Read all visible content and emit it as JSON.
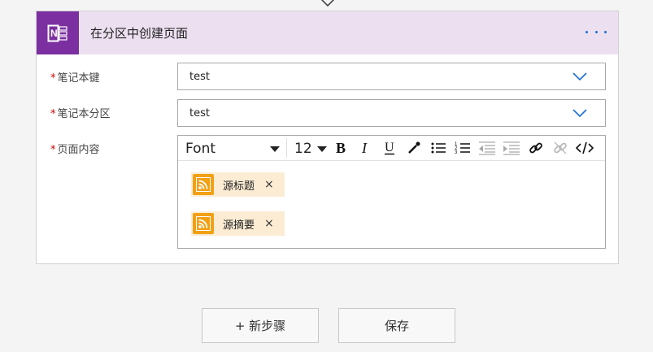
{
  "card": {
    "title": "在分区中创建页面",
    "more_icon": "ellipsis-icon",
    "app_icon": "onenote-icon"
  },
  "fields": {
    "notebook_key": {
      "label": "笔记本键",
      "required": "*",
      "value": "test"
    },
    "notebook_section": {
      "label": "笔记本分区",
      "required": "*",
      "value": "test"
    },
    "page_content": {
      "label": "页面内容",
      "required": "*"
    }
  },
  "editor": {
    "font": "Font",
    "size": "12",
    "tools": [
      "bold-icon",
      "italic-icon",
      "underline-icon",
      "color-picker-icon",
      "bulleted-list-icon",
      "numbered-list-icon",
      "outdent-icon",
      "indent-icon",
      "link-icon",
      "unlink-icon",
      "code-view-icon"
    ],
    "tokens": [
      {
        "label": "源标题",
        "remove": "×"
      },
      {
        "label": "源摘要",
        "remove": "×"
      }
    ]
  },
  "actions": {
    "new_step": "+ 新步骤",
    "save": "保存"
  },
  "colors": {
    "header_bg": "#ece0f0",
    "onenote_purple": "#7b2fa0",
    "accent_blue": "#1a6fd8",
    "rss_orange": "#f2a014",
    "token_bg": "#fcecd4",
    "required_red": "#c00000"
  }
}
